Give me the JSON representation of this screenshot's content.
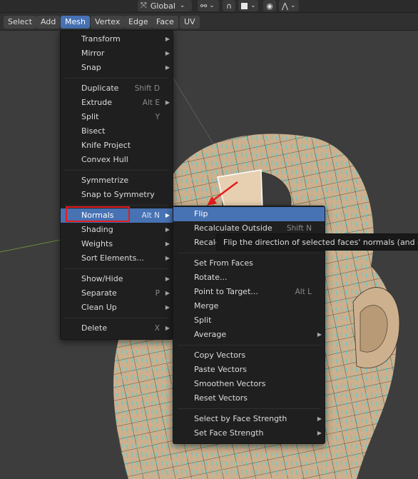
{
  "toolbar": {
    "orientation": "Global"
  },
  "menubar": {
    "items": [
      "Select",
      "Add",
      "Mesh",
      "Vertex",
      "Edge",
      "Face",
      "UV"
    ],
    "active": "Mesh"
  },
  "mesh_menu": {
    "transform": "Transform",
    "mirror": "Mirror",
    "snap": "Snap",
    "duplicate": "Duplicate",
    "duplicate_sc": "Shift D",
    "extrude": "Extrude",
    "extrude_sc": "Alt E",
    "split": "Split",
    "split_sc": "Y",
    "bisect": "Bisect",
    "knife_project": "Knife Project",
    "convex_hull": "Convex Hull",
    "symmetrize": "Symmetrize",
    "snap_to_symmetry": "Snap to Symmetry",
    "normals": "Normals",
    "normals_sc": "Alt N",
    "shading": "Shading",
    "weights": "Weights",
    "sort_elements": "Sort Elements...",
    "show_hide": "Show/Hide",
    "separate": "Separate",
    "separate_sc": "P",
    "clean_up": "Clean Up",
    "delete": "Delete",
    "delete_sc": "X"
  },
  "normals_menu": {
    "flip": "Flip",
    "recalc_outside": "Recalculate Outside",
    "recalc_outside_sc": "Shift N",
    "recalc_inside": "Recalc",
    "set_from_faces": "Set From Faces",
    "rotate": "Rotate...",
    "point_to_target": "Point to Target...",
    "point_to_target_sc": "Alt L",
    "merge": "Merge",
    "split": "Split",
    "average": "Average",
    "copy_vectors": "Copy Vectors",
    "paste_vectors": "Paste Vectors",
    "smoothen_vectors": "Smoothen Vectors",
    "reset_vectors": "Reset Vectors",
    "select_by_face_strength": "Select by Face Strength",
    "set_face_strength": "Set Face Strength"
  },
  "tooltip": {
    "text": "Flip the direction of selected faces' normals (and of their"
  },
  "colors": {
    "menu_bg": "#1f1f1f",
    "highlight": "#4772b3",
    "annotation_red": "#e41c1c",
    "mesh_tan": "#cdb08e",
    "normals_cyan": "#3ad6e0"
  }
}
